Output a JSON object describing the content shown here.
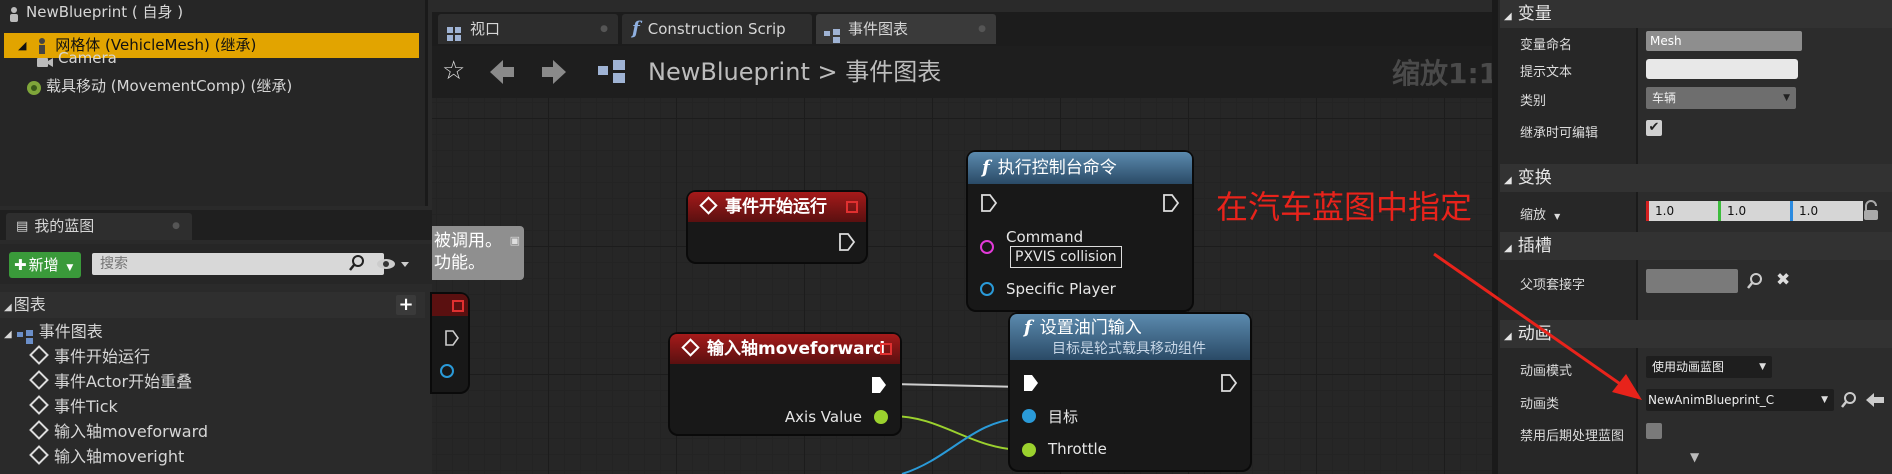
{
  "components": {
    "root": "NewBlueprint ( 自身 )",
    "items": [
      {
        "label": "网格体 (VehicleMesh) (继承)",
        "selected": true
      },
      {
        "label": "Camera"
      },
      {
        "label": "载具移动 (MovementComp) (继承)"
      }
    ]
  },
  "my_blueprint": {
    "tab_label": "我的蓝图",
    "add_label": "新增",
    "search_placeholder": "搜索",
    "graphs_header": "图表",
    "event_graph": "事件图表",
    "events": [
      "事件开始运行",
      "事件Actor开始重叠",
      "事件Tick",
      "输入轴moveforward",
      "输入轴moveright"
    ]
  },
  "editor_tabs": [
    {
      "label": "视口",
      "icon": "viewport-icon"
    },
    {
      "label": "Construction Scrip",
      "icon": "function-icon"
    },
    {
      "label": "事件图表",
      "icon": "graph-icon",
      "active": true
    }
  ],
  "graph": {
    "breadcrumb_root": "NewBlueprint",
    "breadcrumb_sep": ">",
    "breadcrumb_current": "事件图表",
    "zoom": "缩放1:1",
    "comment_partial": [
      "被调用。",
      "功能。"
    ],
    "nodes": {
      "begin_play": {
        "title": "事件开始运行"
      },
      "exec_console": {
        "title": "执行控制台命令",
        "command_label": "Command",
        "command_value": "PXVIS collision",
        "player_label": "Specific Player"
      },
      "input_axis": {
        "title": "输入轴moveforward",
        "axis_label": "Axis Value"
      },
      "set_throttle": {
        "title": "设置油门输入",
        "subtitle": "目标是轮式载具移动组件",
        "target_label": "目标",
        "throttle_label": "Throttle"
      }
    },
    "annotation": "在汽车蓝图中指定",
    "annotation_color": "#e8231b"
  },
  "details": {
    "variables": {
      "header": "变量",
      "name_label": "变量命名",
      "name_value": "Mesh",
      "tooltip_label": "提示文本",
      "tooltip_value": "",
      "category_label": "类别",
      "category_value": "车辆",
      "editable_label": "继承时可编辑",
      "editable_checked": true
    },
    "transform": {
      "header": "变换",
      "scale_label": "缩放",
      "x": "1.0",
      "y": "1.0",
      "z": "1.0"
    },
    "sockets": {
      "header": "插槽",
      "parent_socket_label": "父项套接字",
      "parent_socket_value": ""
    },
    "animation": {
      "header": "动画",
      "mode_label": "动画模式",
      "mode_value": "使用动画蓝图",
      "class_label": "动画类",
      "class_value": "NewAnimBlueprint_C",
      "disable_post_label": "禁用后期处理蓝图",
      "disable_post_checked": false
    }
  }
}
